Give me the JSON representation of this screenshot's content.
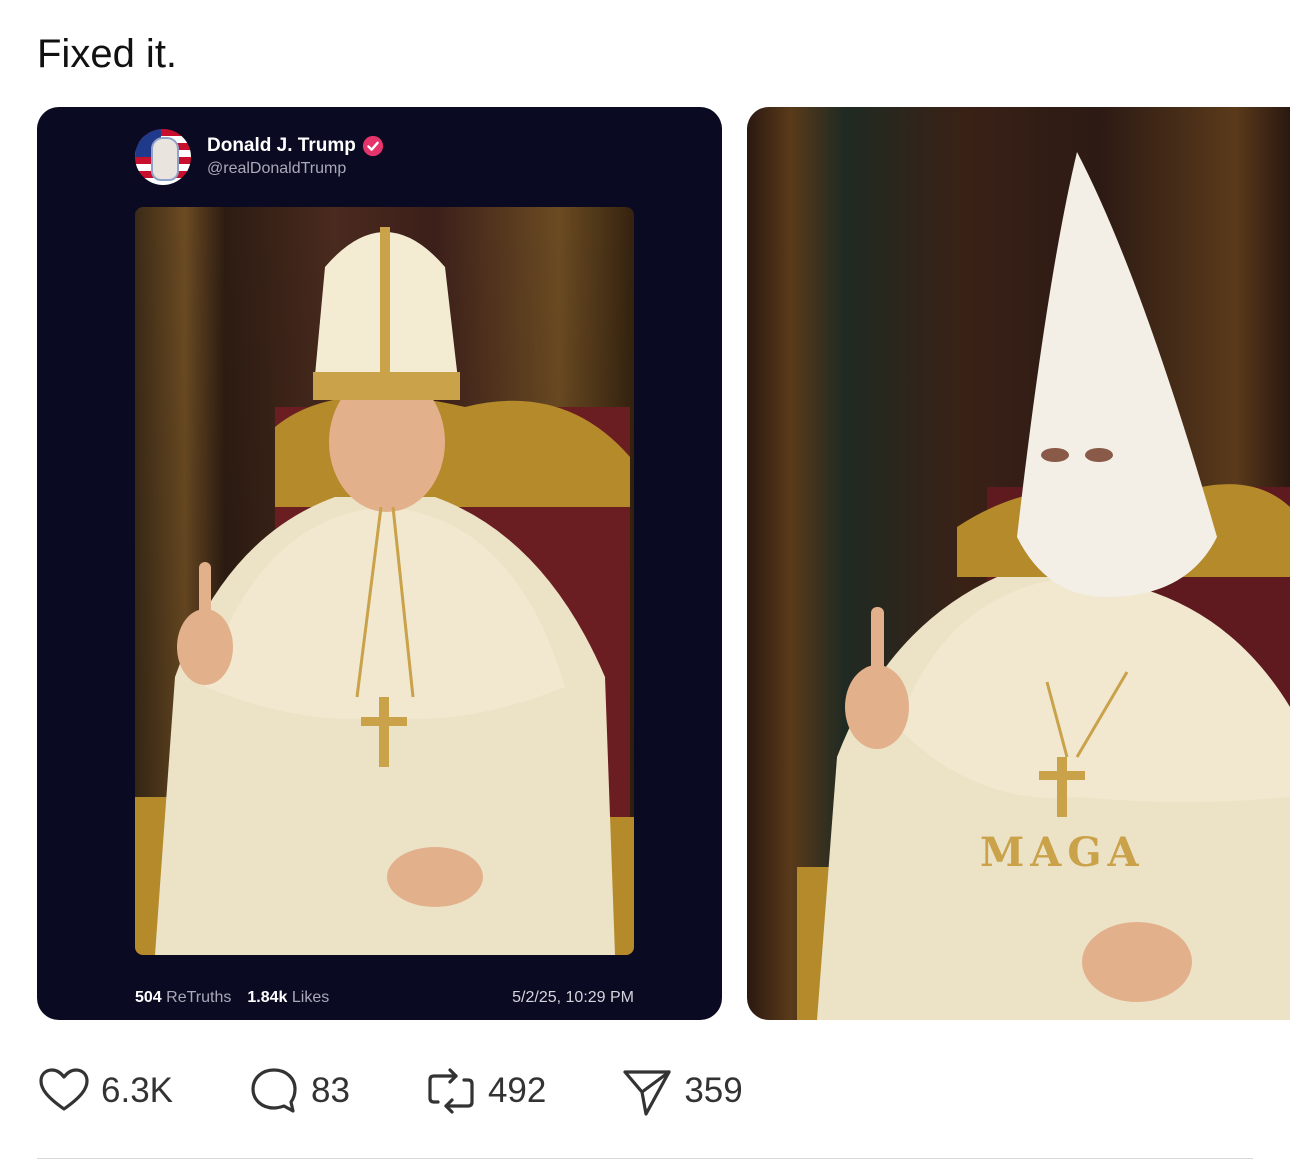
{
  "post": {
    "text": "Fixed it."
  },
  "truth_card": {
    "author_name": "Donald J. Trump",
    "handle": "@realDonaldTrump",
    "retruths_count": "504",
    "retruths_label": "ReTruths",
    "likes_count": "1.84k",
    "likes_label": "Likes",
    "timestamp": "5/2/25, 10:29 PM",
    "verified_color": "#e5336b",
    "background_color": "#0a0a22"
  },
  "photo_card": {
    "robe_text": "MAGA"
  },
  "actions": {
    "likes": "6.3K",
    "replies": "83",
    "reposts": "492",
    "shares": "359"
  },
  "icons": {
    "like": "heart-icon",
    "reply": "speech-bubble-icon",
    "repost": "repost-arrows-icon",
    "share": "paper-plane-icon",
    "verified": "verified-badge-icon"
  }
}
